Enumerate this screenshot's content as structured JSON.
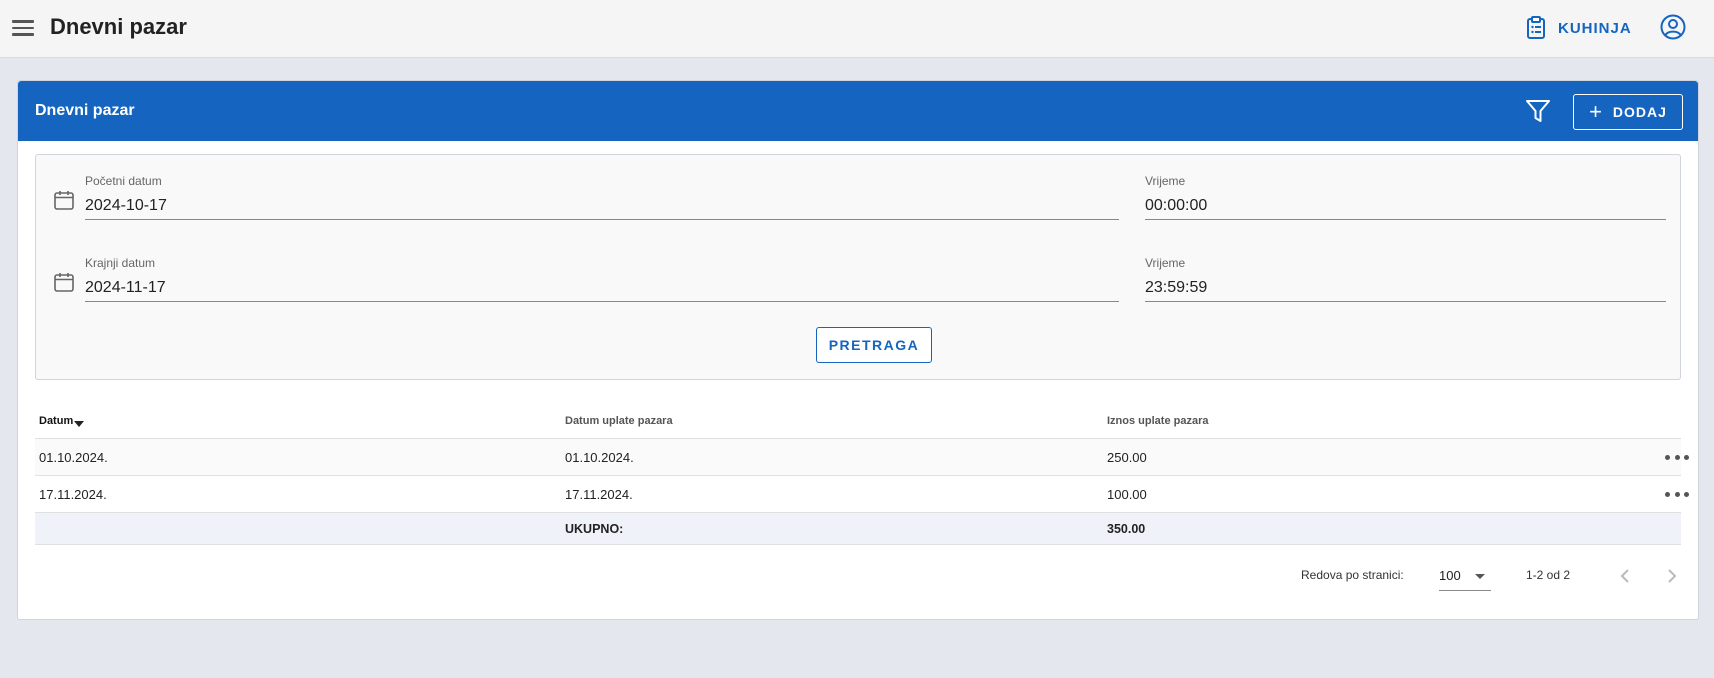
{
  "topbar": {
    "title": "Dnevni pazar",
    "kuhinja_label": "KUHINJA"
  },
  "card": {
    "title": "Dnevni pazar",
    "add_label": "DODAJ"
  },
  "filters": {
    "start_date_label": "Početni datum",
    "start_date_value": "2024-10-17",
    "start_time_label": "Vrijeme",
    "start_time_value": "00:00:00",
    "end_date_label": "Krajnji datum",
    "end_date_value": "2024-11-17",
    "end_time_label": "Vrijeme",
    "end_time_value": "23:59:59",
    "search_label": "PRETRAGA"
  },
  "table": {
    "headers": [
      "Datum",
      "Datum uplate pazara",
      "Iznos uplate pazara"
    ],
    "rows": [
      {
        "datum": "01.10.2024.",
        "datum_uplate": "01.10.2024.",
        "iznos": "250.00"
      },
      {
        "datum": "17.11.2024.",
        "datum_uplate": "17.11.2024.",
        "iznos": "100.00"
      }
    ],
    "total_label": "UKUPNO:",
    "total_value": "350.00"
  },
  "pager": {
    "rows_per_page_label": "Redova po stranici:",
    "rows_per_page_value": "100",
    "range": "1-2 od 2"
  },
  "colors": {
    "primary": "#1565c0",
    "background": "#e4e7ee",
    "total_row": "#f0f2fa"
  }
}
